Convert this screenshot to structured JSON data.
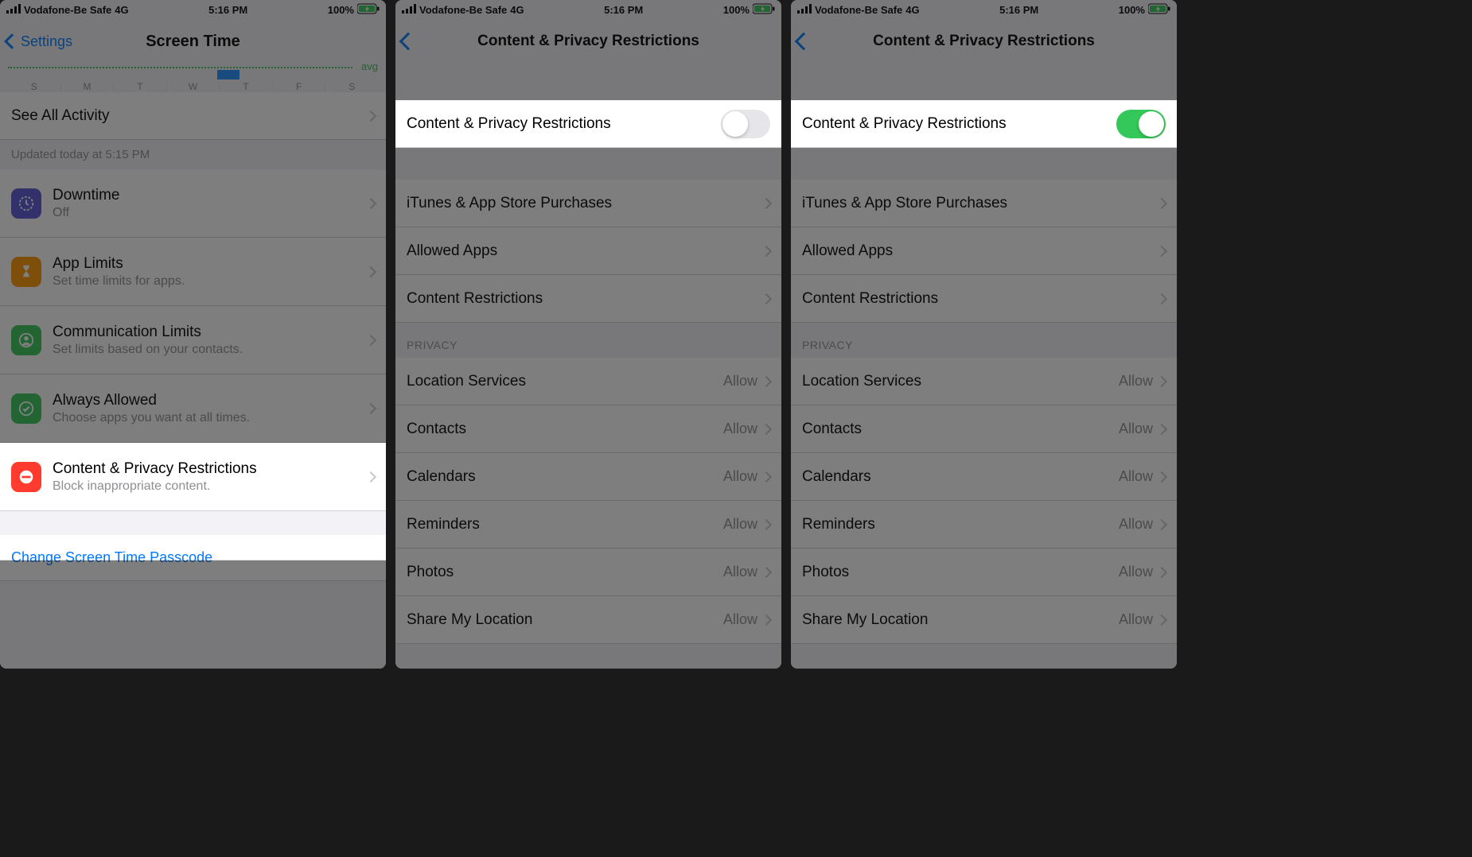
{
  "status": {
    "carrier": "Vodafone-Be Safe",
    "network": "4G",
    "time": "5:16 PM",
    "battery_pct": "100%"
  },
  "phone1": {
    "back_label": "Settings",
    "title": "Screen Time",
    "avg_label": "avg",
    "days": [
      "S",
      "M",
      "T",
      "W",
      "T",
      "F",
      "S"
    ],
    "see_all": "See All Activity",
    "updated": "Updated today at 5:15 PM",
    "rows": [
      {
        "title": "Downtime",
        "sub": "Off",
        "icon_color": "#5856d6"
      },
      {
        "title": "App Limits",
        "sub": "Set time limits for apps.",
        "icon_color": "#ff9500"
      },
      {
        "title": "Communication Limits",
        "sub": "Set limits based on your contacts.",
        "icon_color": "#34c759"
      },
      {
        "title": "Always Allowed",
        "sub": "Choose apps you want at all times.",
        "icon_color": "#34c759"
      },
      {
        "title": "Content & Privacy Restrictions",
        "sub": "Block inappropriate content.",
        "icon_color": "#ff3b30"
      }
    ],
    "link": "Change Screen Time Passcode"
  },
  "restrictions": {
    "title": "Content & Privacy Restrictions",
    "toggle_label": "Content & Privacy Restrictions",
    "group1": [
      "iTunes & App Store Purchases",
      "Allowed Apps",
      "Content Restrictions"
    ],
    "privacy_header": "PRIVACY",
    "privacy_rows": [
      {
        "label": "Location Services",
        "value": "Allow"
      },
      {
        "label": "Contacts",
        "value": "Allow"
      },
      {
        "label": "Calendars",
        "value": "Allow"
      },
      {
        "label": "Reminders",
        "value": "Allow"
      },
      {
        "label": "Photos",
        "value": "Allow"
      },
      {
        "label": "Share My Location",
        "value": "Allow"
      }
    ]
  }
}
